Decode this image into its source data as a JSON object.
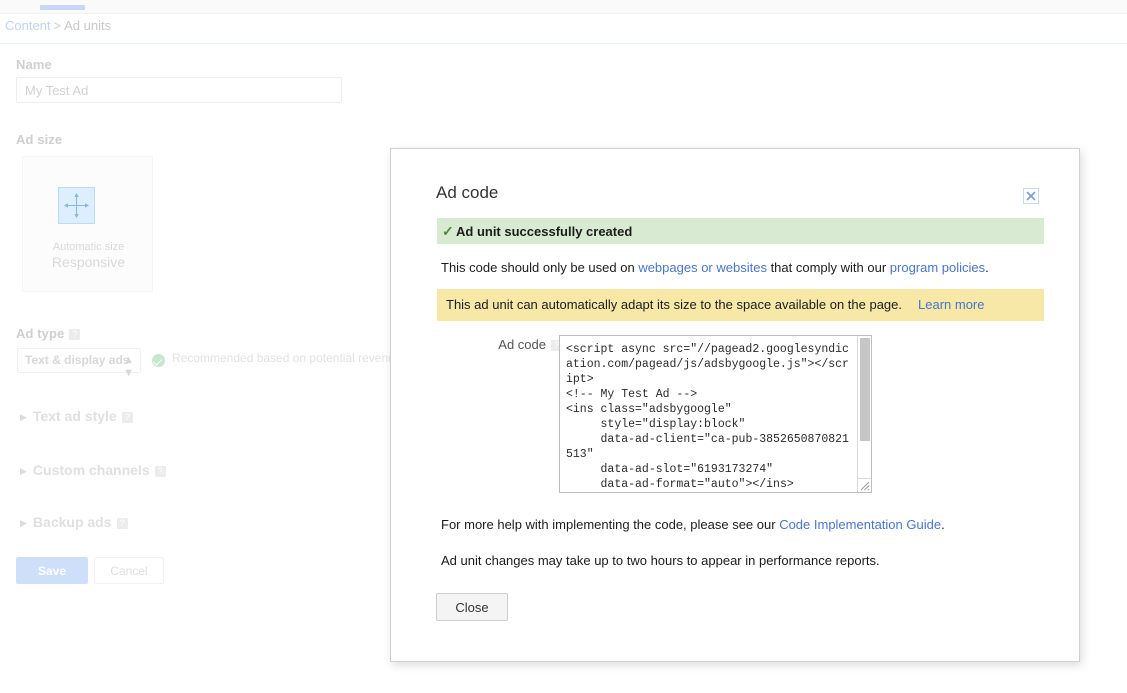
{
  "breadcrumb": {
    "parent": "Content",
    "separator": ">",
    "current": "Ad units"
  },
  "form": {
    "name_label": "Name",
    "name_value": "My Test Ad",
    "name_placeholder": "My Test Ad",
    "adsize_label": "Ad size",
    "adsize_card": {
      "caption_top": "Automatic size",
      "caption_bottom": "Responsive",
      "icon": "resize-arrows-icon"
    },
    "adtype_label": "Ad type",
    "adtype_selected": "Text & display ads",
    "adtype_recommendation": "Recommended based on potential revenue",
    "sections": [
      {
        "label": "Text ad style",
        "expanded": false
      },
      {
        "label": "Custom channels",
        "expanded": false
      },
      {
        "label": "Backup ads",
        "expanded": false
      }
    ],
    "save_label": "Save",
    "cancel_label": "Cancel",
    "help_badge": "?"
  },
  "modal": {
    "title": "Ad code",
    "close_icon": "close-x-icon",
    "success_banner": {
      "icon": "check-mark-icon",
      "text": "Ad unit successfully created"
    },
    "policy_line": {
      "prefix": "This code should only be used on ",
      "link1": "webpages or websites",
      "middle": " that comply with our ",
      "link2": "program policies",
      "suffix": "."
    },
    "adapt_banner": {
      "text": "This ad unit can automatically adapt its size to the space available on the page.",
      "link": "Learn more"
    },
    "adcode_label": "Ad code",
    "adcode_help_badge": "?",
    "adcode_value": "<script async src=\"//pagead2.googlesyndication.com/pagead/js/adsbygoogle.js\"></script>\n<!-- My Test Ad -->\n<ins class=\"adsbygoogle\"\n     style=\"display:block\"\n     data-ad-client=\"ca-pub-3852650870821513\"\n     data-ad-slot=\"6193173274\"\n     data-ad-format=\"auto\"></ins>",
    "help_line": {
      "prefix": "For more help with implementing the code, please see our ",
      "link": "Code Implementation Guide",
      "suffix": "."
    },
    "delay_line": "Ad unit changes may take up to two hours to appear in performance reports.",
    "close_button": "Close"
  },
  "colors": {
    "success_banner_bg": "#d9ead3",
    "adapt_banner_bg": "#f7e8a8",
    "link": "#4876c8",
    "accent_blue": "#c6d8f7",
    "check_green": "#4d8a32"
  }
}
